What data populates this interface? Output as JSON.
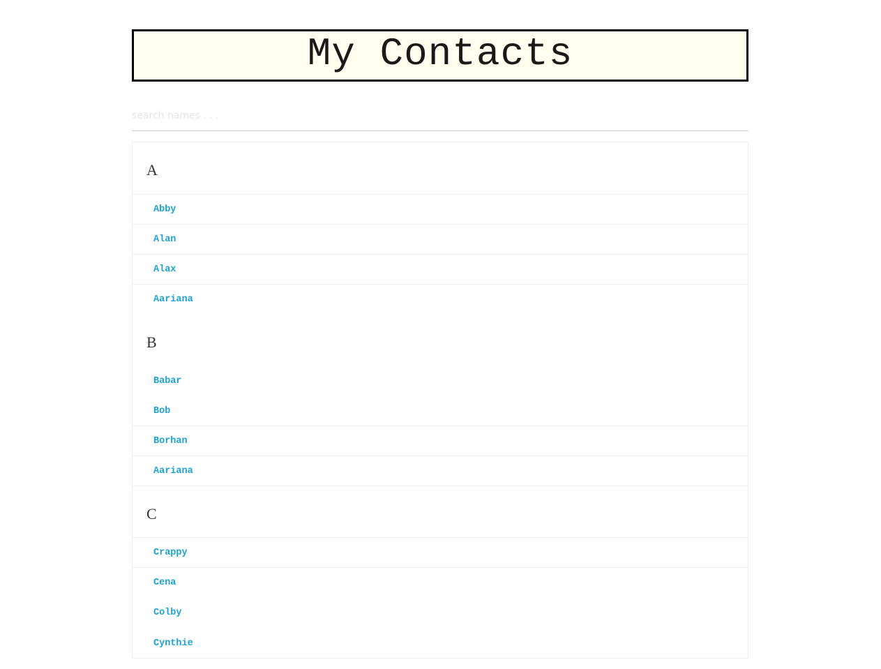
{
  "header": {
    "title": "My Contacts"
  },
  "search": {
    "placeholder": "search names . . ."
  },
  "groups": [
    {
      "letter": "A",
      "contacts": [
        "Abby",
        "Alan",
        "Alax",
        "Aariana"
      ]
    },
    {
      "letter": "B",
      "contacts": [
        "Babar",
        "Bob",
        "Borhan",
        "Aariana"
      ]
    },
    {
      "letter": "C",
      "contacts": [
        "Crappy",
        "Cena",
        "Colby",
        "Cynthie"
      ]
    }
  ],
  "colors": {
    "title_background": "#fffff0",
    "title_border": "#000000",
    "contact_link": "#1ba3d3",
    "divider": "#eeeeee"
  }
}
